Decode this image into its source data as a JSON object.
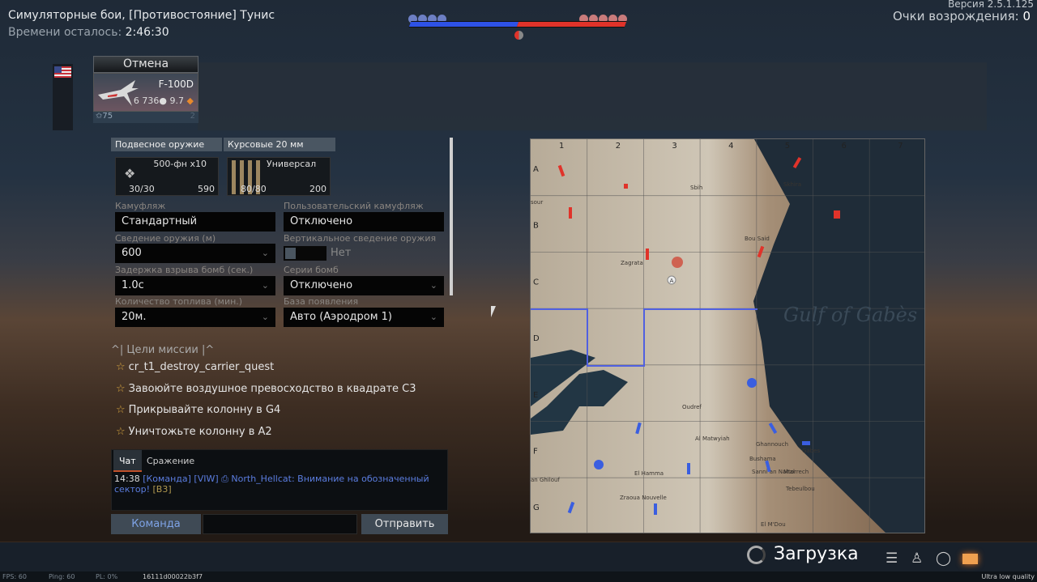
{
  "header": {
    "title": "Симуляторные бои, [Противостояние] Тунис",
    "time_label": "Времени осталось:",
    "time_value": "2:46:30",
    "version": "Версия 2.5.1.125",
    "respawn_label": "Очки возрождения:",
    "respawn_value": "0"
  },
  "score": {
    "blue_tickets": 4,
    "red_tickets": 5,
    "blue_color": "#2e52e6",
    "red_color": "#e0332a"
  },
  "vehicle": {
    "cancel_label": "Отмена",
    "name": "F-100D",
    "cost": "6 736",
    "br": "9.7",
    "rank_points": "75",
    "count": "2",
    "country": "USA"
  },
  "weapons": {
    "tabs": [
      "Подвесное оружие",
      "Курсовые 20 мм"
    ],
    "slots": [
      {
        "name": "500-фн x10",
        "ammo": "30/30",
        "cost": "590"
      },
      {
        "name": "Универсал",
        "ammo": "80/80",
        "cost": "200"
      }
    ]
  },
  "settings": [
    {
      "label": "Камуфляж",
      "value": "Стандартный"
    },
    {
      "label": "Пользовательский камуфляж",
      "value": "Отключено"
    },
    {
      "label": "Сведение оружия (м)",
      "value": "600"
    },
    {
      "label": "Вертикальное сведение оружия",
      "value": "Нет"
    },
    {
      "label": "Задержка взрыва бомб (сек.)",
      "value": "1.0c"
    },
    {
      "label": "Серии бомб",
      "value": "Отключено"
    },
    {
      "label": "Количество топлива (мин.)",
      "value": "20м."
    },
    {
      "label": "База появления",
      "value": "Авто (Аэродром 1)"
    }
  ],
  "mission": {
    "header": "Цели миссии",
    "objectives": [
      "cr_t1_destroy_carrier_quest",
      "Завоюйте воздушное превосходство в квадрате  C3",
      "Прикрывайте колонну в  G4",
      "Уничтожьте колонну в  A2"
    ]
  },
  "chat": {
    "tabs": [
      "Чат",
      "Сражение"
    ],
    "time": "14:38",
    "message": "[Команда] [VIW] ⎙ North_Hellcat: Внимание на обозначенный сектор!",
    "grid_ref": "[B3]",
    "channel_button": "Команда",
    "input_value": "",
    "send_button": "Отправить"
  },
  "map": {
    "columns": [
      "1",
      "2",
      "3",
      "4",
      "5",
      "6",
      "7"
    ],
    "rows": [
      "A",
      "B",
      "C",
      "D",
      "E",
      "F",
      "G"
    ],
    "labels": [
      "Sbih",
      "Skhira",
      "sour",
      "Bou Said",
      "Zagrata",
      "Gulf of Gabès",
      "Oudref",
      "Al Matwyiah",
      "Ghannouch",
      "Gabes",
      "Bushama",
      "Mtorrech",
      "Sanni an Nahal",
      "Tebeulbou",
      "El Hamma",
      "an Ghilouf",
      "Zraoua Nouvelle",
      "El M'Dou"
    ],
    "capture_point": "A"
  },
  "bottom": {
    "loading": "Загрузка"
  },
  "status": {
    "fps": "FPS: 60",
    "ping": "Ping: 60",
    "pl": "PL: 0%",
    "session": "16111d00022b3f7",
    "quality": "Ultra low quality"
  }
}
